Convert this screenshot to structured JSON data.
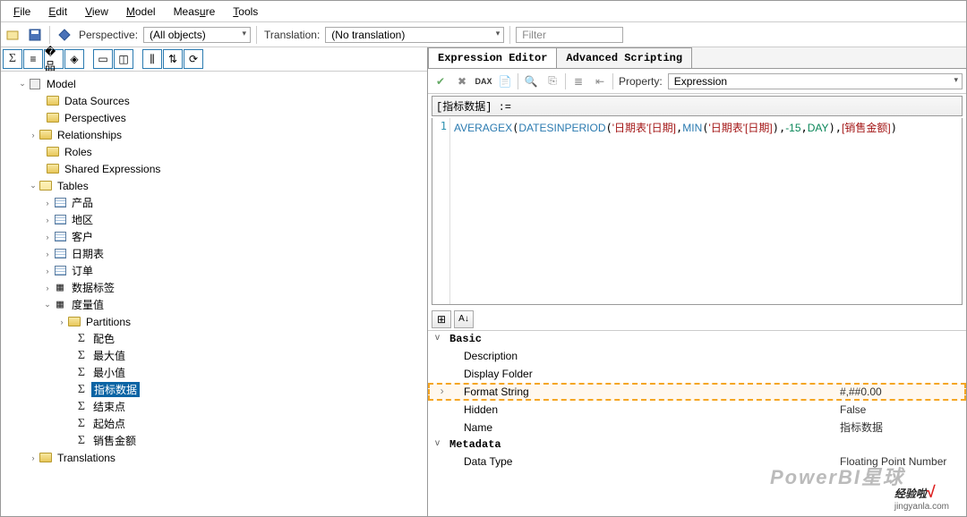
{
  "menu": {
    "file": "File",
    "edit": "Edit",
    "view": "View",
    "model": "Model",
    "measure": "Measure",
    "tools": "Tools"
  },
  "toolbar": {
    "perspective_label": "Perspective:",
    "perspective_value": "(All objects)",
    "translation_label": "Translation:",
    "translation_value": "(No translation)",
    "filter_placeholder": "Filter"
  },
  "tree": {
    "root": "Model",
    "data_sources": "Data Sources",
    "perspectives": "Perspectives",
    "relationships": "Relationships",
    "roles": "Roles",
    "shared_expressions": "Shared Expressions",
    "tables": "Tables",
    "table_items": [
      "产品",
      "地区",
      "客户",
      "日期表",
      "订单",
      "数据标签"
    ],
    "measure_table": "度量值",
    "partitions": "Partitions",
    "measures": [
      "配色",
      "最大值",
      "最小值",
      "指标数据",
      "结束点",
      "起始点",
      "销售金额"
    ],
    "selected_measure": "指标数据",
    "translations": "Translations"
  },
  "tabs": {
    "editor": "Expression Editor",
    "scripting": "Advanced Scripting"
  },
  "editor": {
    "property_label": "Property:",
    "property_value": "Expression",
    "expr_name": "[指标数据] :=",
    "line_no": "1",
    "code_fn1": "AVERAGEX",
    "code_fn2": "DATESINPERIOD",
    "code_ref1": "'日期表'[日期]",
    "code_fn3": "MIN",
    "code_ref2": "'日期表'[日期]",
    "code_num": "-15",
    "code_kw": "DAY",
    "code_ref3": "[销售金额]"
  },
  "props": {
    "section_basic": "Basic",
    "description": "Description",
    "display_folder": "Display Folder",
    "format_string": "Format String",
    "format_string_val": "#,##0.00",
    "hidden": "Hidden",
    "hidden_val": "False",
    "name": "Name",
    "name_val": "指标数据",
    "section_metadata": "Metadata",
    "data_type": "Data Type",
    "data_type_val": "Floating Point Number"
  },
  "watermark": {
    "text1": "PowerBI星球",
    "text2": "经验啦",
    "domain": "jingyanla.com"
  }
}
